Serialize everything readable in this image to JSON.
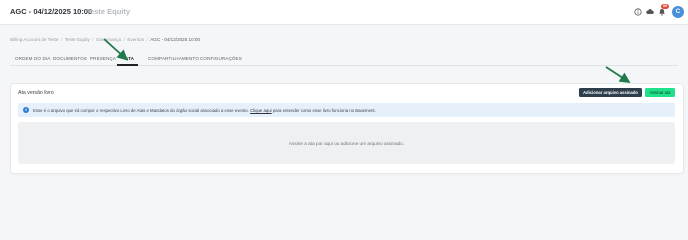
{
  "header": {
    "title": "AGC - 04/12/2025 10:00",
    "subtitle": "Teste Equity",
    "notification_count": "99",
    "avatar_initial": "C"
  },
  "breadcrumb": [
    "Billing Account de Teste",
    "Teste Equity",
    "Governança",
    "Eventos",
    "AGC - 04/12/2025 10:00"
  ],
  "tabs": [
    {
      "label": "ORDEM DO DIA",
      "active": false
    },
    {
      "label": "DOCUMENTOS",
      "active": false
    },
    {
      "label": "PRESENÇA",
      "active": false
    },
    {
      "label": "ATA",
      "active": true
    },
    {
      "label": "COMPARTILHAMENTO",
      "active": false
    },
    {
      "label": "CONFIGURAÇÕES",
      "active": false
    }
  ],
  "ata": {
    "section_title": "Ata versão livro",
    "add_button_label": "Adicionar arquivo assinado",
    "sign_button_label": "Assinar ata",
    "info_text_before": "Esse é o arquivo que irá compor o respectivo Livro de Atas e Mandatos do órgão social associado a esse evento.",
    "info_link_text": "Clique aqui",
    "info_text_after": "para entender como esse livro funciona no Basement.",
    "dropzone_text": "Assine a ata por aqui ou adicione um arquivo assinado."
  },
  "colors": {
    "primary_dark": "#2f3e4d",
    "accent_green": "#21e08a",
    "info_bg": "#e6f0fb",
    "annotation_arrow": "#1f7a4c"
  },
  "icons": [
    "info-circle-icon",
    "cloud-icon",
    "bell-icon",
    "annotation-arrow-icon"
  ]
}
